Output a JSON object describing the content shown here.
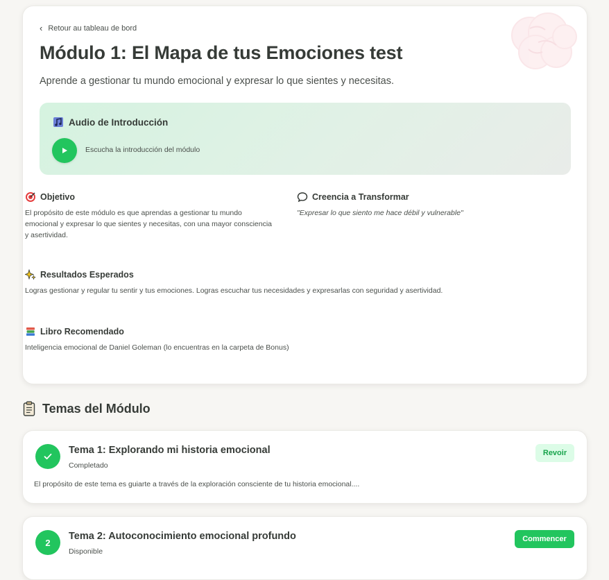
{
  "header": {
    "back_label": "Retour au tableau de bord",
    "title": "Módulo 1: El Mapa de tus Emociones test",
    "subtitle": "Aprende a gestionar tu mundo emocional y expresar lo que sientes y necesitas."
  },
  "audio": {
    "title": "Audio de Introducción",
    "description": "Escucha la introducción del módulo"
  },
  "sections": {
    "objetivo": {
      "title": "Objetivo",
      "body": "El propósito de este módulo es que aprendas a gestionar tu mundo emocional y expresar lo que sientes y necesitas, con una mayor consciencia y asertividad."
    },
    "creencia": {
      "title": "Creencia a Transformar",
      "body": "\"Expresar lo que siento me hace débil y vulnerable\""
    },
    "resultados": {
      "title": "Resultados Esperados",
      "body": "Logras gestionar y regular tu sentir y tus emociones. Logras escuchar tus necesidades y expresarlas con seguridad y asertividad."
    },
    "libro": {
      "title": "Libro Recomendado",
      "body": "Inteligencia emocional de Daniel Goleman (lo encuentras en la carpeta de Bonus)"
    }
  },
  "topics": {
    "heading": "Temas del Módulo",
    "items": [
      {
        "title": "Tema 1: Explorando mi historia emocional",
        "status": "Completado",
        "description": "El propósito de este tema es guiarte a través de la exploración consciente de tu historia emocional....",
        "action": "Revoir"
      },
      {
        "number": "2",
        "title": "Tema 2: Autoconocimiento emocional profundo",
        "status": "Disponible",
        "action": "Commencer"
      }
    ]
  },
  "icons": {
    "back": "chevron-left-icon",
    "audio": "music-note-icon",
    "play": "play-icon",
    "objetivo": "target-icon",
    "creencia": "speech-bubble-icon",
    "resultados": "sparkles-icon",
    "libro": "books-icon",
    "topics": "clipboard-icon",
    "completed": "checkmark-icon",
    "decoration": "brain-icon"
  },
  "colors": {
    "accent": "#22c55e",
    "accent_soft": "#dcfce7",
    "accent_text": "#16a34a",
    "background": "#f7f6f3",
    "card": "#ffffff",
    "text": "#363b37"
  }
}
